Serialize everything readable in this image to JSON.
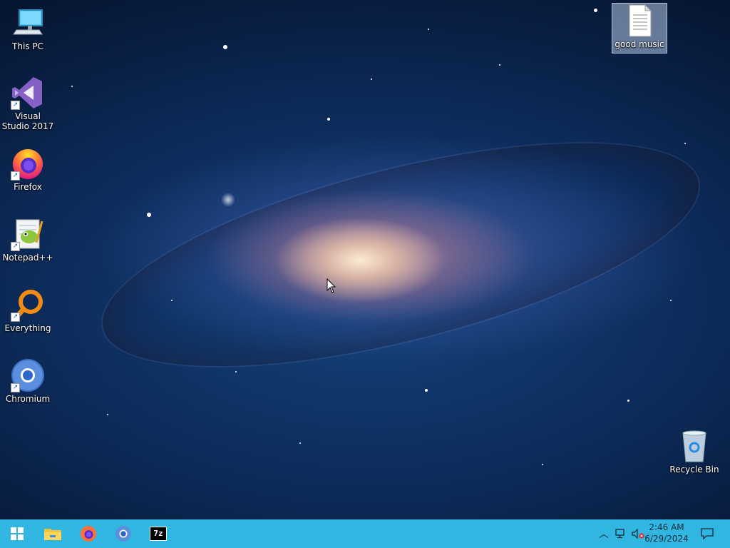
{
  "desktop": {
    "icons": [
      {
        "label": "This PC",
        "icon": "computer-icon"
      },
      {
        "label": "Visual Studio 2017",
        "icon": "visual-studio-icon"
      },
      {
        "label": "Firefox",
        "icon": "firefox-icon"
      },
      {
        "label": "Notepad++",
        "icon": "notepadpp-icon"
      },
      {
        "label": "Everything",
        "icon": "everything-icon"
      },
      {
        "label": "Chromium",
        "icon": "chromium-icon"
      }
    ],
    "file": {
      "label": "good music",
      "icon": "text-file-icon"
    },
    "recycle_bin": {
      "label": "Recycle Bin",
      "icon": "recycle-bin-icon"
    }
  },
  "taskbar": {
    "pinned": [
      "start-icon",
      "file-explorer-icon",
      "firefox-icon",
      "chromium-icon",
      "7zip-icon"
    ],
    "sevenzip_text": "7z",
    "clock": {
      "time": "2:46 AM",
      "date": "6/29/2024"
    },
    "tray": [
      "chevron-up-icon",
      "network-icon",
      "volume-muted-icon",
      "notification-icon"
    ],
    "color": "#31b6e2"
  }
}
